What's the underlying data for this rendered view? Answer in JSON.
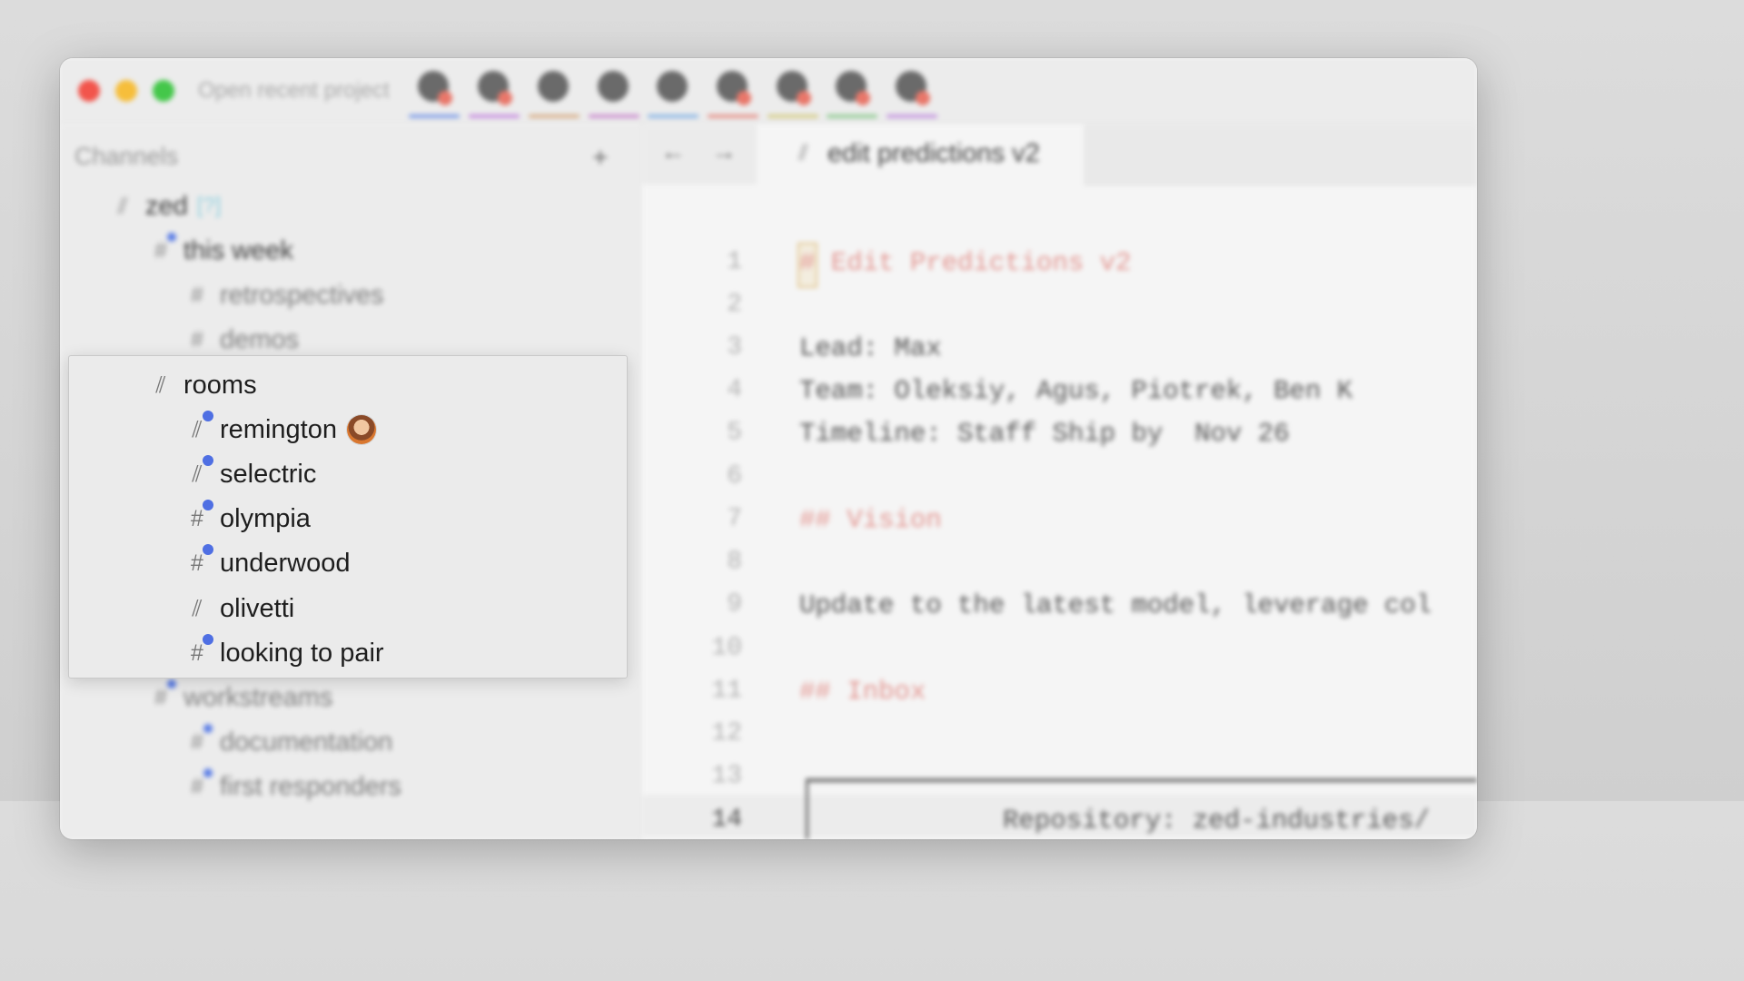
{
  "titlebar": {
    "recent_project": "Open recent project",
    "underline_colors": [
      "#7f9ee8",
      "#c88ee0",
      "#d9b08a",
      "#cc8fd0",
      "#8cb6e6",
      "#e6948c",
      "#d6cd8a",
      "#92cc94",
      "#c597e0"
    ]
  },
  "sidebar": {
    "title": "Channels",
    "add_icon": "+",
    "items": [
      {
        "label": "zed",
        "icon": "broadcast-icon",
        "note": "[?]"
      },
      {
        "label": "this week",
        "icon": "hash-icon"
      },
      {
        "label": "retrospectives",
        "icon": "hash-icon"
      },
      {
        "label": "demos",
        "icon": "hash-icon"
      },
      {
        "label": "workstreams",
        "icon": "hash-icon"
      },
      {
        "label": "documentation",
        "icon": "hash-icon"
      },
      {
        "label": "first responders",
        "icon": "hash-icon"
      }
    ]
  },
  "popup": {
    "parent": "rooms",
    "items": [
      {
        "label": "remington",
        "icon": "broadcast-icon",
        "unread": true,
        "avatar": true
      },
      {
        "label": "selectric",
        "icon": "broadcast-icon",
        "unread": true
      },
      {
        "label": "olympia",
        "icon": "hash-icon",
        "unread": true
      },
      {
        "label": "underwood",
        "icon": "hash-icon",
        "unread": true
      },
      {
        "label": "olivetti",
        "icon": "broadcast-icon",
        "unread": false
      },
      {
        "label": "looking to pair",
        "icon": "hash-icon",
        "unread": true
      }
    ]
  },
  "editor": {
    "nav_back": "←",
    "nav_forward": "→",
    "tab_title": "edit predictions v2",
    "line_numbers": [
      "1",
      "2",
      "3",
      "4",
      "5",
      "6",
      "7",
      "8",
      "9",
      "10",
      "11",
      "12",
      "13",
      "14"
    ],
    "lines": {
      "l1": "# Edit Predictions v2",
      "l3": "Lead: Max",
      "l4": "Team: Oleksiy, Agus, Piotrek, Ben K",
      "l5": "Timeline: Staff Ship by  Nov 26",
      "l7": "## Vision",
      "l9": "Update to the latest model, leverage col",
      "l11": "## Inbox",
      "l14": "Repository: zed-industries/"
    }
  },
  "colors": {
    "accent": "#4f6fe3",
    "heading": "#e39590"
  }
}
